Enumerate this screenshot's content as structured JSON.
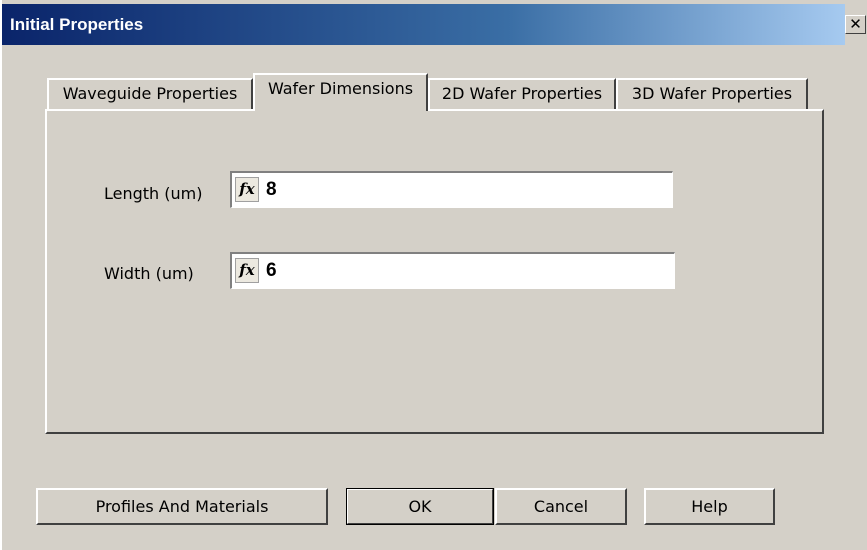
{
  "window": {
    "title": "Initial Properties",
    "close_glyph": "✕"
  },
  "tabs": [
    {
      "label": "Waveguide Properties",
      "active": false
    },
    {
      "label": "Wafer Dimensions",
      "active": true
    },
    {
      "label": "2D Wafer Properties",
      "active": false
    },
    {
      "label": "3D Wafer Properties",
      "active": false
    }
  ],
  "fields": {
    "length": {
      "label": "Length (um)",
      "icon": "fx-icon",
      "value": "8"
    },
    "width": {
      "label": "Width (um)",
      "icon": "fx-icon",
      "value": "6"
    }
  },
  "fx_glyph": "fx",
  "buttons": {
    "profiles": "Profiles And Materials",
    "ok": "OK",
    "cancel": "Cancel",
    "help": "Help"
  },
  "colors": {
    "title_start": "#0a246a",
    "title_end": "#a6caf0",
    "face": "#d4d0c8"
  }
}
